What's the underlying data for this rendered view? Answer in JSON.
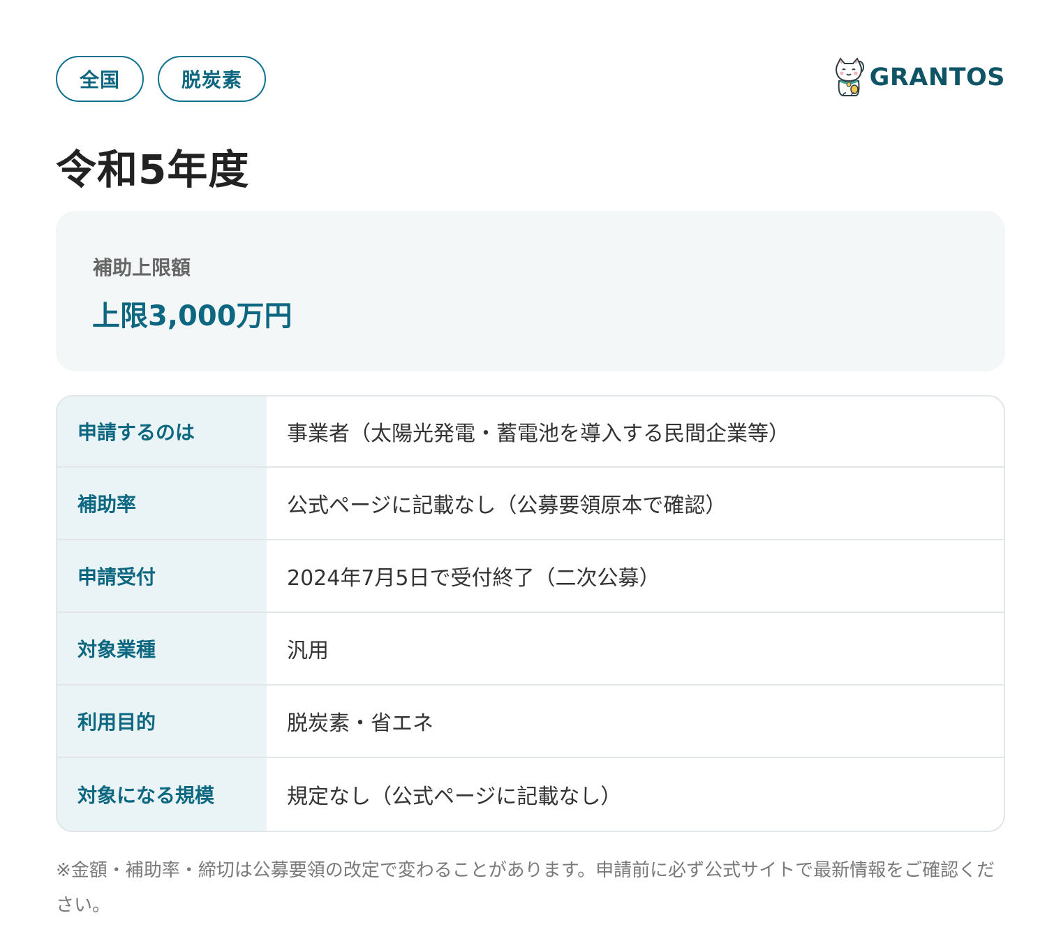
{
  "tags": [
    "全国",
    "脱炭素"
  ],
  "brand": {
    "name": "GRANTOS",
    "logo_icon": "maneki-neko-cat-icon"
  },
  "title": "令和5年度",
  "amount": {
    "label": "補助上限額",
    "value": "上限3,000万円"
  },
  "details": [
    {
      "label": "申請するのは",
      "value": "事業者（太陽光発電・蓄電池を導入する民間企業等）"
    },
    {
      "label": "補助率",
      "value": "公式ページに記載なし（公募要領原本で確認）"
    },
    {
      "label": "申請受付",
      "value": "2024年7月5日で受付終了（二次公募）"
    },
    {
      "label": "対象業種",
      "value": "汎用"
    },
    {
      "label": "利用目的",
      "value": "脱炭素・省エネ"
    },
    {
      "label": "対象になる規模",
      "value": "規定なし（公式ページに記載なし）"
    }
  ],
  "note": "※金額・補助率・締切は公募要領の改定で変わることがあります。申請前に必ず公式サイトで最新情報をご確認ください。",
  "colors": {
    "accent": "#0e6780",
    "brand": "#0f5465",
    "label_bg": "#eaf4f6",
    "card_bg": "#f4f7f8"
  }
}
